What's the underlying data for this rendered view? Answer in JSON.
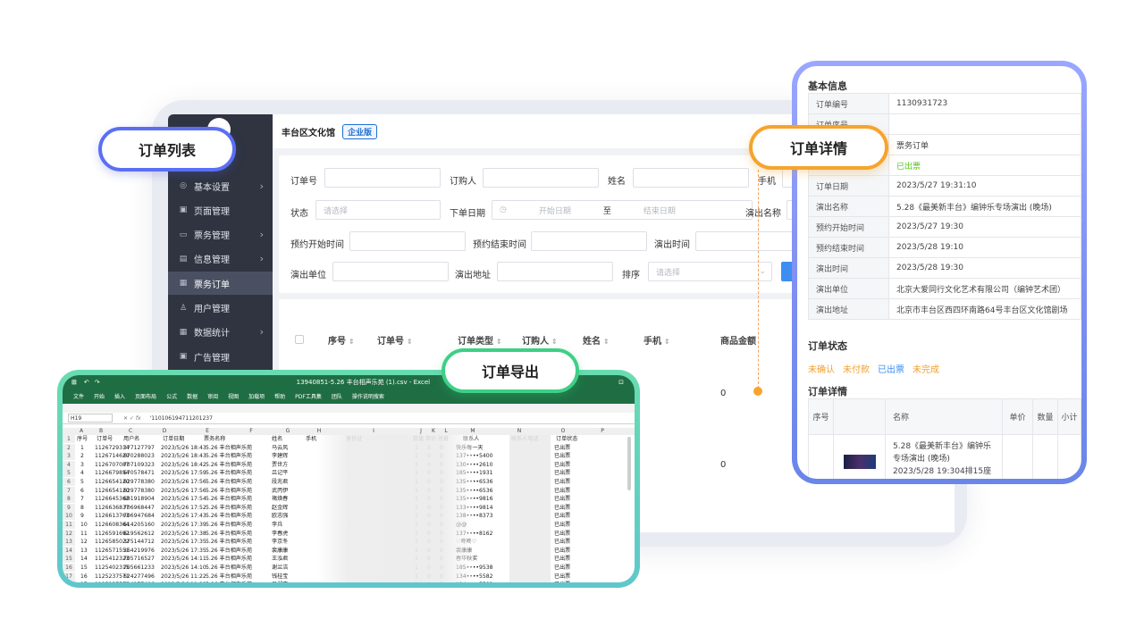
{
  "badges": {
    "order_list": "订单列表",
    "order_detail": "订单详情",
    "order_export": "订单导出"
  },
  "admin": {
    "venue": "丰台区文化馆",
    "edition": "企业版",
    "sidebar": [
      {
        "label": "基本设置",
        "icon": "gear-icon",
        "glyph": "◎",
        "has_children": true
      },
      {
        "label": "页面管理",
        "icon": "page-icon",
        "glyph": "▣",
        "has_children": false
      },
      {
        "label": "票务管理",
        "icon": "ticket-icon",
        "glyph": "▭",
        "has_children": true
      },
      {
        "label": "信息管理",
        "icon": "info-icon",
        "glyph": "▤",
        "has_children": true
      },
      {
        "label": "票务订单",
        "icon": "order-icon",
        "glyph": "▦",
        "has_children": false,
        "active": true
      },
      {
        "label": "用户管理",
        "icon": "user-icon",
        "glyph": "♙",
        "has_children": false
      },
      {
        "label": "数据统计",
        "icon": "stats-icon",
        "glyph": "▦",
        "has_children": true
      },
      {
        "label": "广告管理",
        "icon": "ad-icon",
        "glyph": "▣",
        "has_children": false
      }
    ],
    "filters": {
      "order_no": "订单号",
      "buyer": "订购人",
      "name": "姓名",
      "phone": "手机",
      "status": "状态",
      "status_placeholder": "请选择",
      "order_date": "下单日期",
      "start_date": "开始日期",
      "date_sep": "至",
      "end_date": "结束日期",
      "show_name": "演出名称",
      "book_start": "预约开始时间",
      "book_end": "预约结束时间",
      "show_time": "演出时间",
      "show_unit": "演出单位",
      "show_address": "演出地址",
      "sort": "排序",
      "sort_placeholder": "请选择"
    },
    "columns": [
      "序号",
      "订单号",
      "订单类型",
      "订购人",
      "姓名",
      "手机",
      "商品金额"
    ],
    "rows": [
      {
        "amount": "0"
      },
      {
        "amount": "0"
      }
    ]
  },
  "detail": {
    "basic_title": "基本信息",
    "fields": [
      {
        "k": "订单编号",
        "v": "1130931723"
      },
      {
        "k": "订单序号",
        "v": ""
      },
      {
        "k": "订单类型",
        "v": "票务订单"
      },
      {
        "k": "订单状态",
        "v": "已出票",
        "color": "#52c41a"
      },
      {
        "k": "订单日期",
        "v": "2023/5/27 19:31:10"
      },
      {
        "k": "演出名称",
        "v": "5.28《最美新丰台》编钟乐专场演出 (晚场)"
      },
      {
        "k": "预约开始时间",
        "v": "2023/5/27 19:30"
      },
      {
        "k": "预约结束时间",
        "v": "2023/5/28 19:10"
      },
      {
        "k": "演出时间",
        "v": "2023/5/28 19:30"
      },
      {
        "k": "演出单位",
        "v": "北京大爱同行文化艺术有限公司（编钟艺术团）"
      },
      {
        "k": "演出地址",
        "v": "北京市丰台区西四环南路64号丰台区文化馆剧场"
      }
    ],
    "status_title": "订单状态",
    "statuses": [
      {
        "label": "未确认",
        "color": "#f0a030"
      },
      {
        "label": "未付款",
        "color": "#f0a030"
      },
      {
        "label": "已出票",
        "color": "#3d8ef0"
      },
      {
        "label": "未完成",
        "color": "#f0a030"
      }
    ],
    "items_title": "订单详情",
    "item_headers": [
      "序号",
      "名称",
      "单价",
      "数量",
      "小计"
    ],
    "item": {
      "name": "5.28《最美新丰台》编钟乐专场演出 (晚场)",
      "time": "2023/5/28 19:304排15座"
    }
  },
  "excel": {
    "title": "13940851-5.26 丰台相声乐苑 (1).csv - Excel",
    "menu": [
      "文件",
      "开始",
      "插入",
      "页面布局",
      "公式",
      "数据",
      "审阅",
      "视图",
      "加载项",
      "帮助",
      "PDF工具集",
      "团队",
      "操作说明搜索"
    ],
    "name_box": "H19",
    "formula": "'110106194711201237",
    "col_letters": [
      "A",
      "B",
      "C",
      "D",
      "E",
      "F",
      "G",
      "H",
      "I",
      "J",
      "K",
      "L",
      "M",
      "N",
      "O",
      "P"
    ],
    "headers": [
      "序号",
      "订单号",
      "用户名",
      "订单日期",
      "票务名称",
      "姓名",
      "手机",
      "身份证",
      "数量",
      "单价",
      "总价",
      "联系人",
      "联系人电话",
      "订单状态"
    ],
    "rows": [
      {
        "no": "1",
        "order": "1126729314",
        "user": "377127797",
        "date": "2023/5/26 18:43",
        "ticket": "5.26 丰台相声乐苑",
        "name": "马云风",
        "contact": "快乐每一天",
        "status": "已出票"
      },
      {
        "no": "2",
        "order": "1126714629",
        "user": "670288023",
        "date": "2023/5/26 18:43",
        "ticket": "5.26 丰台相声乐苑",
        "name": "李建辉",
        "contact": "137••••5400",
        "status": "已出票"
      },
      {
        "no": "3",
        "order": "1126707087",
        "user": "707109323",
        "date": "2023/5/26 18:42",
        "ticket": "5.26 丰台相声乐苑",
        "name": "贾世方",
        "contact": "130••••2610",
        "status": "已出票"
      },
      {
        "no": "4",
        "order": "1126679854",
        "user": "670578471",
        "date": "2023/5/26 17:59",
        "ticket": "5.26 丰台相声乐苑",
        "name": "吕记平",
        "contact": "185••••1931",
        "status": "已出票"
      },
      {
        "no": "5",
        "order": "1126654120",
        "user": "629778380",
        "date": "2023/5/26 17:56",
        "ticket": "5.26 丰台相声乐苑",
        "name": "段兆君",
        "contact": "135••••6536",
        "status": "已出票"
      },
      {
        "no": "6",
        "order": "1126654120",
        "user": "629778380",
        "date": "2023/5/26 17:56",
        "ticket": "5.26 丰台相声乐苑",
        "name": "武丙伊",
        "contact": "135••••6536",
        "status": "已出票"
      },
      {
        "no": "7",
        "order": "1126645362",
        "user": "691918904",
        "date": "2023/5/26 17:54",
        "ticket": "5.26 丰台相声乐苑",
        "name": "褚焕春",
        "contact": "135••••9816",
        "status": "已出票"
      },
      {
        "no": "8",
        "order": "1126636837",
        "user": "706968447",
        "date": "2023/5/26 17:52",
        "ticket": "5.26 丰台相声乐苑",
        "name": "赵金辉",
        "contact": "133••••9814",
        "status": "已出票"
      },
      {
        "no": "9",
        "order": "1126613763",
        "user": "706947684",
        "date": "2023/5/26 17:43",
        "ticket": "5.26 丰台相声乐苑",
        "name": "欧志强",
        "contact": "138••••8373",
        "status": "已出票"
      },
      {
        "no": "10",
        "order": "1126608364",
        "user": "614205160",
        "date": "2023/5/26 17:39",
        "ticket": "5.26 丰台相声乐苑",
        "name": "李兵",
        "contact": "@@",
        "status": "已出票"
      },
      {
        "no": "11",
        "order": "1126591692",
        "user": "619562612",
        "date": "2023/5/26 17:38",
        "ticket": "5.26 丰台相声乐苑",
        "name": "李春虎",
        "contact": "137••••8162",
        "status": "已出票"
      },
      {
        "no": "12",
        "order": "1126585022",
        "user": "375144712",
        "date": "2023/5/26 17:35",
        "ticket": "5.26 丰台相声乐苑",
        "name": "李京冬",
        "contact": "♡咚咚♡",
        "status": "已出票"
      },
      {
        "no": "13",
        "order": "1126571551",
        "user": "364219976",
        "date": "2023/5/26 17:35",
        "ticket": "5.26 丰台相声乐苑",
        "name": "裴康康",
        "contact": "裴康康",
        "status": "已出票"
      },
      {
        "no": "14",
        "order": "1125412323",
        "user": "705716527",
        "date": "2023/5/26 14:11",
        "ticket": "5.26 丰台相声乐苑",
        "name": "王泓君",
        "contact": "春华秋实",
        "status": "已出票"
      },
      {
        "no": "15",
        "order": "1125402315",
        "user": "705661233",
        "date": "2023/5/26 14:10",
        "ticket": "5.26 丰台相声乐苑",
        "name": "谢兰洁",
        "contact": "185••••9538",
        "status": "已出票"
      },
      {
        "no": "16",
        "order": "1125237571",
        "user": "624277496",
        "date": "2023/5/26 11:22",
        "ticket": "5.26 丰台相声乐苑",
        "name": "钱桂宝",
        "contact": "134••••5582",
        "status": "已出票"
      },
      {
        "no": "17",
        "order": "1125237571",
        "user": "624277496",
        "date": "2023/5/26 11:22",
        "ticket": "5.26 丰台相声乐苑",
        "name": "吴湘宝",
        "contact": "134••••5582",
        "status": "已出票"
      }
    ],
    "qty": "1",
    "price": "0",
    "total": "0"
  }
}
